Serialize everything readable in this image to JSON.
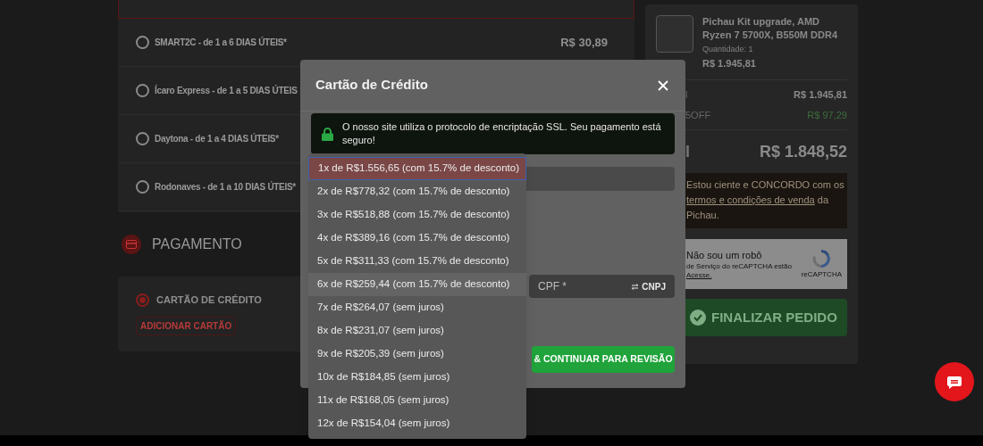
{
  "shipping": {
    "options": [
      {
        "label": "SMART2C - de 1 a 6 DIAS ÚTEIS*",
        "price": "R$ 30,89",
        "selected": false
      },
      {
        "label": "Ícaro Express - de 1 a 5 DIAS ÚTEIS",
        "selected": false
      },
      {
        "label": "Daytona - de 1 a 4 DIAS ÚTEIS*",
        "selected": false
      },
      {
        "label": "Rodonaves - de 1 a 10 DIAS ÚTEIS*",
        "selected": false
      }
    ]
  },
  "payment": {
    "title": "PAGAMENTO",
    "methods": [
      {
        "label": "CARTÃO DE CRÉDITO",
        "selected": true
      }
    ],
    "add_card_button": "ADICIONAR CARTÃO"
  },
  "summary": {
    "product": {
      "name": "Pichau Kit upgrade, AMD Ryzen 7 5700X, B550M DDR4",
      "quantity": "Quantidade: 1",
      "price": "R$ 1.945,81"
    },
    "lines": [
      {
        "label": "l",
        "value": "R$ 1.945,81",
        "kind": "normal"
      },
      {
        "label": "5OFF",
        "value": "R$ 97,29",
        "kind": "discount"
      }
    ],
    "total": {
      "label": "l",
      "value": "R$ 1.848,52"
    },
    "terms": {
      "before": "Estou ciente e CONCORDO com os",
      "link": "termos e condições de venda",
      "after": "da Pichau."
    },
    "captcha": {
      "label": "Não sou um robô",
      "note": "de Serviço do reCAPTCHA estão",
      "link": "Acesse.",
      "brand": "reCAPTCHA"
    },
    "finish_button": "FINALIZAR PEDIDO"
  },
  "modal": {
    "title": "Cartão de Crédito",
    "notice": "O nosso site utiliza o protocolo de encriptação SSL. Seu pagamento está seguro!",
    "document_field": {
      "placeholder": "CPF *",
      "toggle": "CNPJ"
    },
    "submit_button": "& CONTINUAR PARA REVISÃO"
  },
  "installments": [
    {
      "label": "1x de R$1.556,65 (com 15.7% de desconto)",
      "selected": true,
      "highlighted": false
    },
    {
      "label": "2x de R$778,32 (com 15.7% de desconto)",
      "selected": false,
      "highlighted": false
    },
    {
      "label": "3x de R$518,88 (com 15.7% de desconto)",
      "selected": false,
      "highlighted": false
    },
    {
      "label": "4x de R$389,16 (com 15.7% de desconto)",
      "selected": false,
      "highlighted": false
    },
    {
      "label": "5x de R$311,33 (com 15.7% de desconto)",
      "selected": false,
      "highlighted": false
    },
    {
      "label": "6x de R$259,44 (com 15.7% de desconto)",
      "selected": false,
      "highlighted": true
    },
    {
      "label": "7x de R$264,07 (sem juros)",
      "selected": false,
      "highlighted": false
    },
    {
      "label": "8x de R$231,07 (sem juros)",
      "selected": false,
      "highlighted": false
    },
    {
      "label": "9x de R$205,39 (sem juros)",
      "selected": false,
      "highlighted": false
    },
    {
      "label": "10x de R$184,85 (sem juros)",
      "selected": false,
      "highlighted": false
    },
    {
      "label": "11x de R$168,05 (sem juros)",
      "selected": false,
      "highlighted": false
    },
    {
      "label": "12x de R$154,04 (sem juros)",
      "selected": false,
      "highlighted": false
    }
  ]
}
